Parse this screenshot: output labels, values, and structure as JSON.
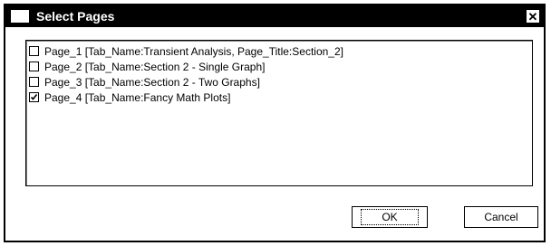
{
  "dialog": {
    "title": "Select Pages",
    "close_icon": "close-icon",
    "items": [
      {
        "label": "Page_1 [Tab_Name:Transient Analysis, Page_Title:Section_2]",
        "checked": false
      },
      {
        "label": "Page_2 [Tab_Name:Section 2 - Single Graph]",
        "checked": false
      },
      {
        "label": "Page_3 [Tab_Name:Section 2 - Two Graphs]",
        "checked": false
      },
      {
        "label": "Page_4 [Tab_Name:Fancy Math Plots]",
        "checked": true
      }
    ],
    "ok_label": "OK",
    "cancel_label": "Cancel"
  }
}
